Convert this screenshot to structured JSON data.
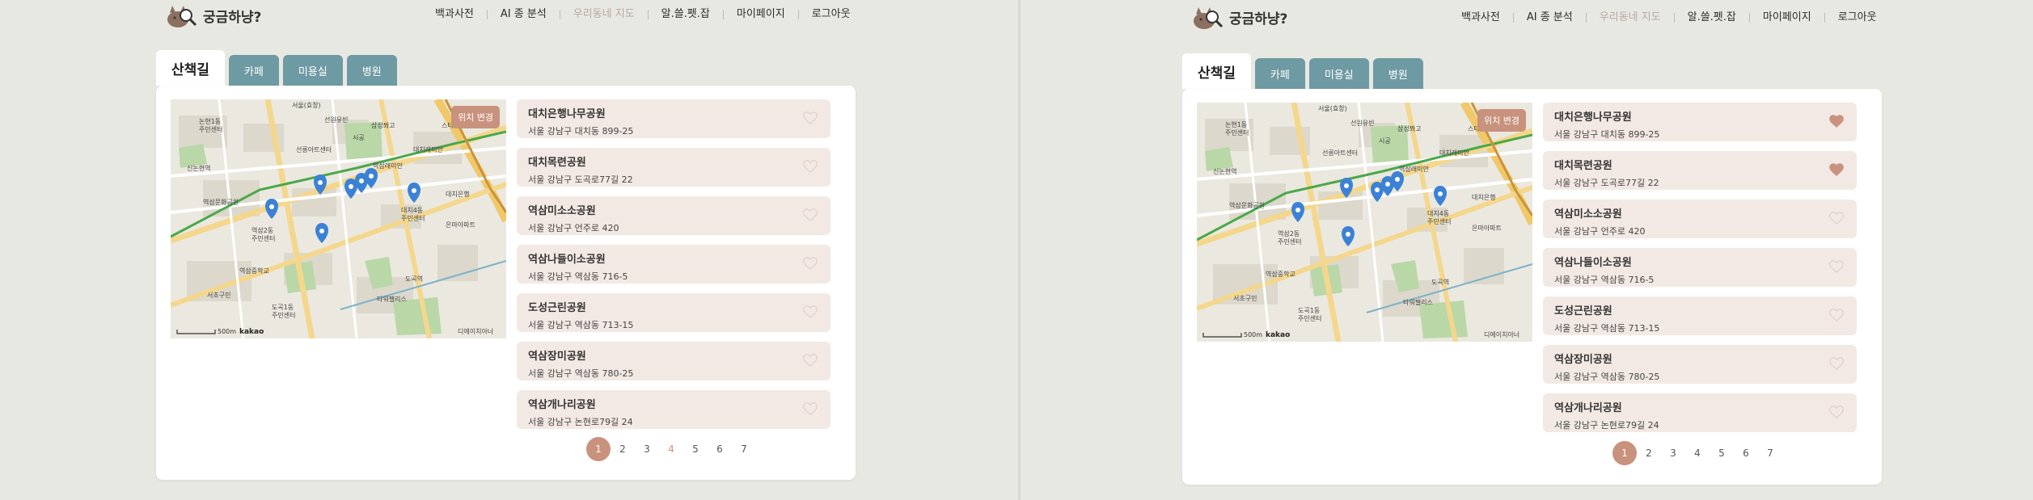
{
  "app": {
    "logo_text": "궁금하냥?",
    "nav": [
      {
        "label": "백과사전"
      },
      {
        "label": "AI 종 분석"
      },
      {
        "label": "우리동네 지도"
      },
      {
        "label": "알.쓸.펫.잡"
      },
      {
        "label": "마이페이지"
      },
      {
        "label": "로그아웃"
      }
    ],
    "tabs": [
      {
        "label": "산책길"
      },
      {
        "label": "카페"
      },
      {
        "label": "미용실"
      },
      {
        "label": "병원"
      }
    ],
    "map": {
      "button_label": "위치 변경",
      "scale_label": "500m",
      "brand_label": "kakao",
      "labels": [
        "서울(효창)",
        "선원유빈",
        "삼성쫘고",
        "스타필드",
        "논현1동",
        "주민센터",
        "시공",
        "대치래미안",
        "선릉아트센터",
        "역삼래미안",
        "신논현역",
        "역삼문화공원",
        "대치은행",
        "대치4동",
        "주민센터",
        "역삼2동",
        "주민센터",
        "도곡1동",
        "주민센터",
        "서초구민",
        "역삼중학교",
        "은마아파트",
        "타워팰리스",
        "도곡역",
        "디에이치아너"
      ]
    },
    "colors": {
      "accent": "#c8927d",
      "tab": "#6e9aa3",
      "card": "#f3e9e4",
      "background": "#e8e8e3"
    }
  },
  "left": {
    "places": [
      {
        "name": "대치은행나무공원",
        "address": "서울 강남구 대치동 899-25",
        "liked": false
      },
      {
        "name": "대치목련공원",
        "address": "서울 강남구 도곡로77길 22",
        "liked": false
      },
      {
        "name": "역삼미소소공원",
        "address": "서울 강남구 언주로 420",
        "liked": false
      },
      {
        "name": "역삼나들이소공원",
        "address": "서울 강남구 역삼동 716-5",
        "liked": false
      },
      {
        "name": "도성근린공원",
        "address": "서울 강남구 역삼동 713-15",
        "liked": false
      },
      {
        "name": "역삼장미공원",
        "address": "서울 강남구 역삼동 780-25",
        "liked": false
      },
      {
        "name": "역삼개나리공원",
        "address": "서울 강남구 논현로79길 24",
        "liked": false
      }
    ],
    "pages": [
      "1",
      "2",
      "3",
      "4",
      "5",
      "6",
      "7"
    ],
    "current_page": "1"
  },
  "right": {
    "places": [
      {
        "name": "대치은행나무공원",
        "address": "서울 강남구 대치동 899-25",
        "liked": true
      },
      {
        "name": "대치목련공원",
        "address": "서울 강남구 도곡로77길 22",
        "liked": true
      },
      {
        "name": "역삼미소소공원",
        "address": "서울 강남구 언주로 420",
        "liked": false
      },
      {
        "name": "역삼나들이소공원",
        "address": "서울 강남구 역삼동 716-5",
        "liked": false
      },
      {
        "name": "도성근린공원",
        "address": "서울 강남구 역삼동 713-15",
        "liked": false
      },
      {
        "name": "역삼장미공원",
        "address": "서울 강남구 역삼동 780-25",
        "liked": false
      },
      {
        "name": "역삼개나리공원",
        "address": "서울 강남구 논현로79길 24",
        "liked": false
      }
    ],
    "pages": [
      "1",
      "2",
      "3",
      "4",
      "5",
      "6",
      "7"
    ],
    "current_page": "1"
  }
}
